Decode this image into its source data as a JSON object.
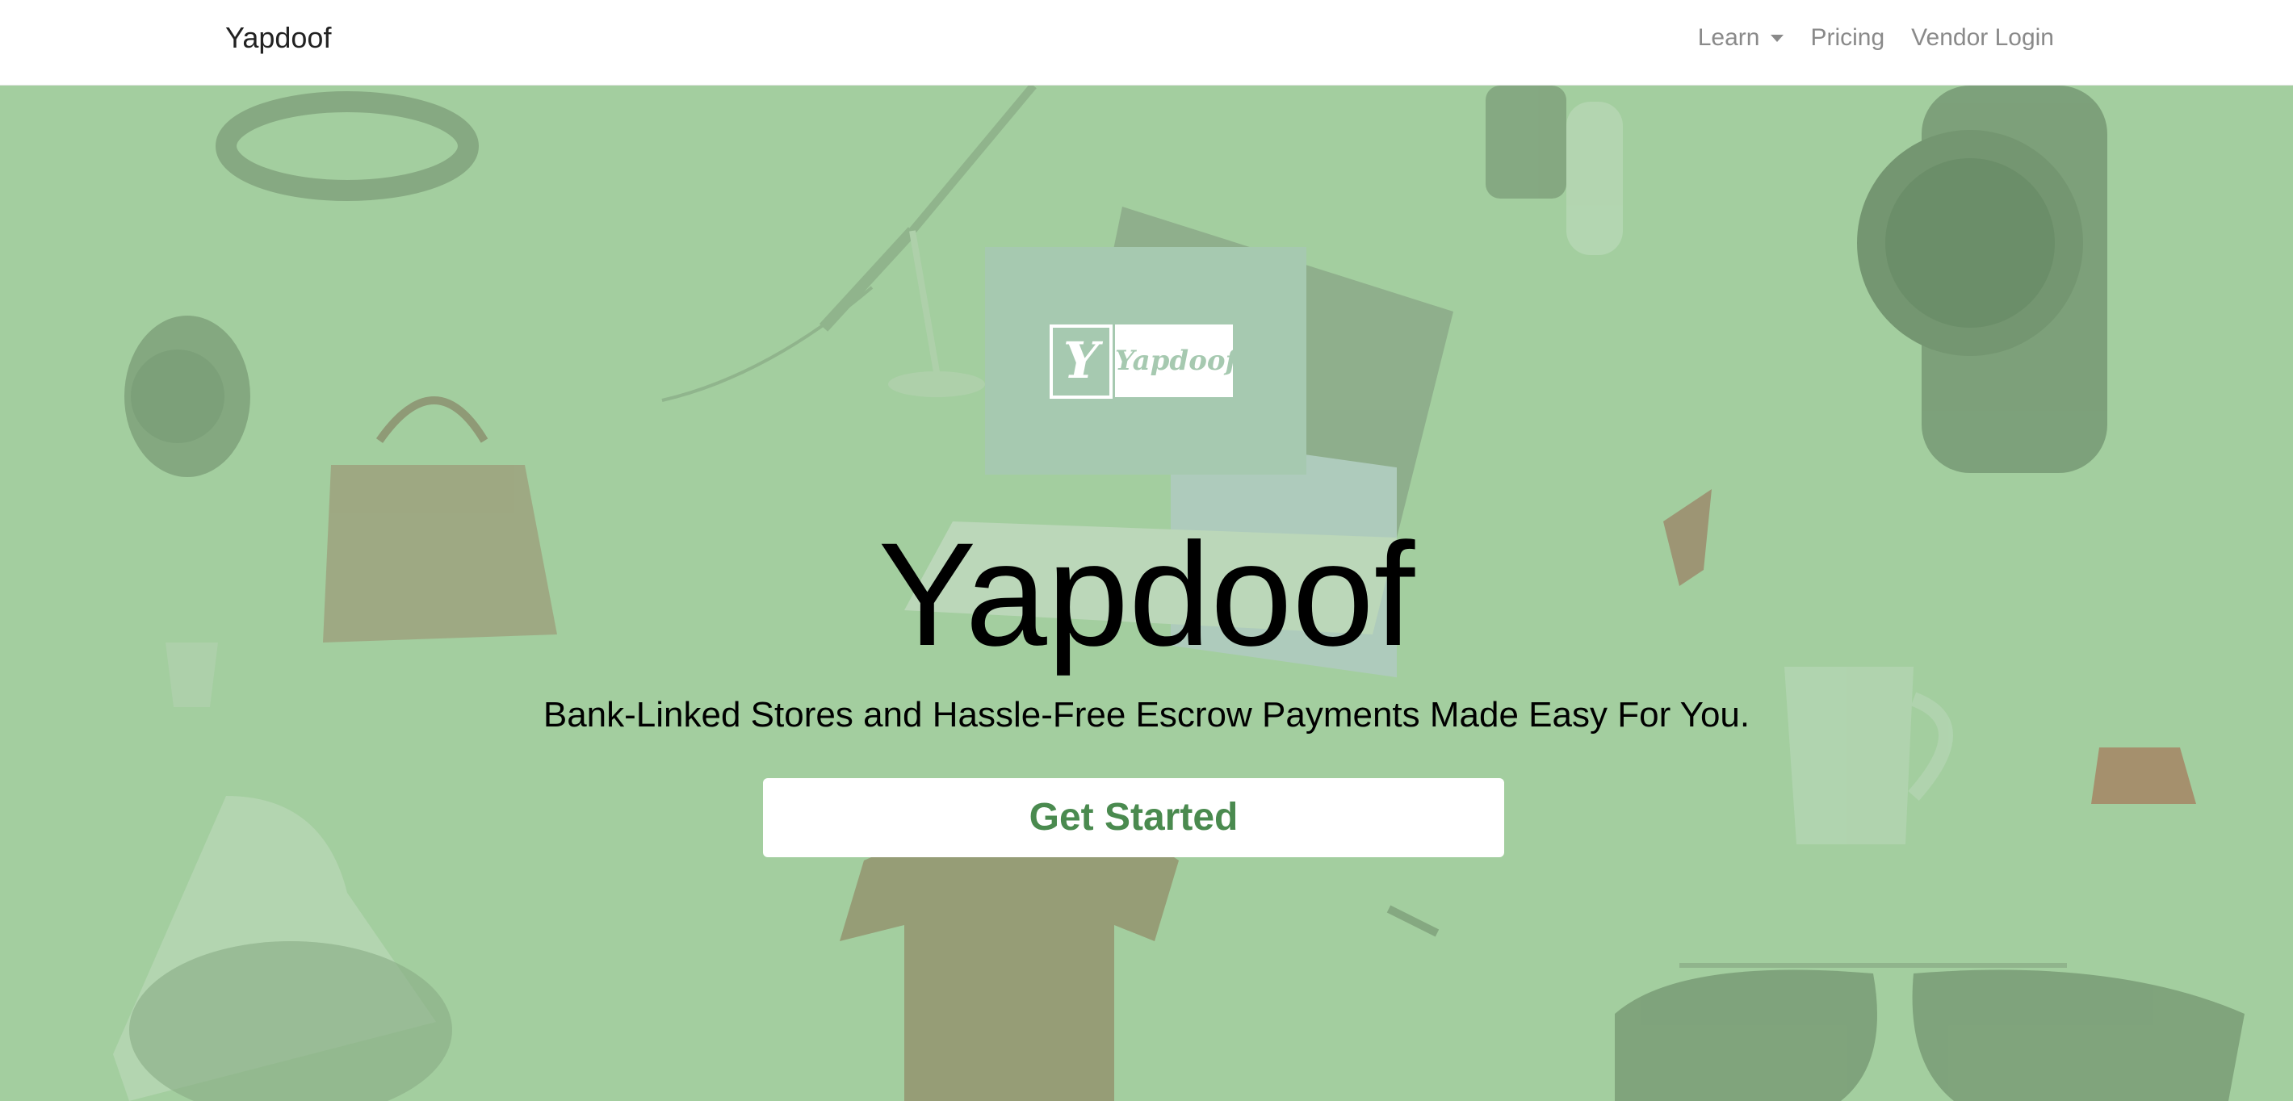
{
  "navbar": {
    "brand": "Yapdoof",
    "links": [
      {
        "label": "Learn",
        "has_dropdown": true
      },
      {
        "label": "Pricing"
      },
      {
        "label": "Vendor Login"
      }
    ]
  },
  "hero": {
    "logo": {
      "monogram": "Y",
      "wordmark": "Yapdoof"
    },
    "title": "Yapdoof",
    "subtitle": "Bank-Linked Stores and Hassle-Free Escrow Payments Made Easy For You.",
    "cta_label": "Get Started",
    "background_items": [
      "belt",
      "desk-lamp",
      "smartwatch",
      "wristwatch",
      "handbag",
      "laptop",
      "cup",
      "mug",
      "sneaker",
      "t-shirt",
      "sunglasses",
      "purse",
      "pen"
    ]
  },
  "colors": {
    "hero_bg": "#a3ce9f",
    "logo_bg": "#a6c9b0",
    "cta_text": "#4a8a4f",
    "nav_text": "#8a8a8a"
  }
}
